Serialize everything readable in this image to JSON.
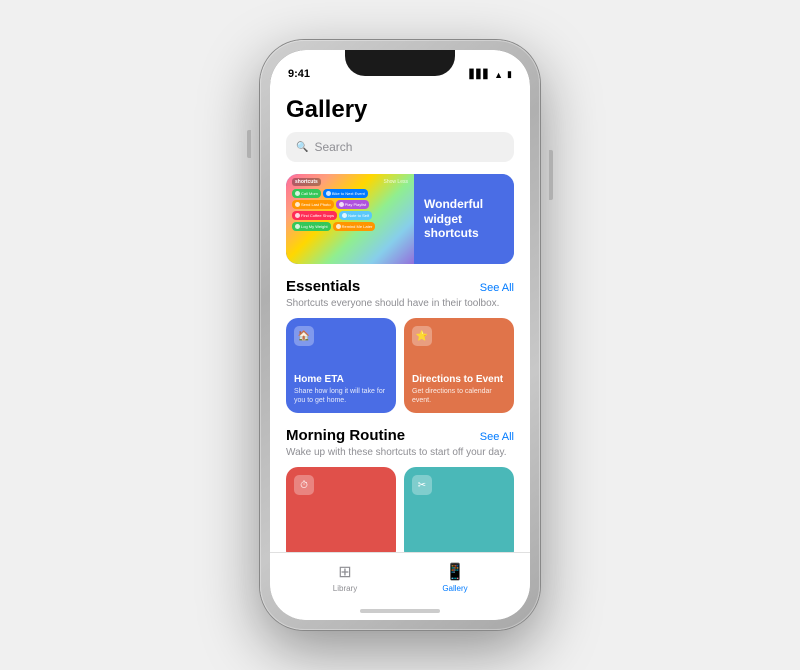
{
  "statusBar": {
    "time": "9:41",
    "signal": "▋▋▋",
    "wifi": "WiFi",
    "battery": "🔋"
  },
  "screen": {
    "title": "Gallery",
    "search": {
      "placeholder": "Search"
    },
    "featured": {
      "rightTitle": "Wonderful widget shortcuts",
      "shortcuts": [
        {
          "label": "Call Mom",
          "color": "#34c759"
        },
        {
          "label": "Bike to Next Event",
          "color": "#007aff"
        },
        {
          "label": "Send Last Photo",
          "color": "#ff9500"
        },
        {
          "label": "Play Playlist",
          "color": "#af52de"
        },
        {
          "label": "Find Coffee Shops",
          "color": "#ff2d55"
        },
        {
          "label": "Note to Self",
          "color": "#5ac8fa"
        },
        {
          "label": "Log My Weight",
          "color": "#34c759"
        },
        {
          "label": "Remind Me Later",
          "color": "#ff9500"
        }
      ]
    },
    "sections": [
      {
        "id": "essentials",
        "title": "Essentials",
        "seeAll": "See All",
        "description": "Shortcuts everyone should have in their toolbox.",
        "cards": [
          {
            "id": "home-eta",
            "title": "Home ETA",
            "description": "Share how long it will take for you to get home.",
            "color": "#4a6de5",
            "icon": "🏠"
          },
          {
            "id": "directions-event",
            "title": "Directions to Event",
            "description": "Get directions to calendar event.",
            "color": "#e0744a",
            "icon": "⭐"
          }
        ]
      },
      {
        "id": "morning-routine",
        "title": "Morning Routine",
        "seeAll": "See All",
        "description": "Wake up with these shortcuts to start off your day.",
        "cards": [
          {
            "id": "card-red",
            "title": "",
            "description": "",
            "color": "#e0504a",
            "icon": "⏱"
          },
          {
            "id": "card-teal",
            "title": "",
            "description": "",
            "color": "#4ab8b8",
            "icon": "✂"
          }
        ]
      }
    ],
    "tabBar": {
      "tabs": [
        {
          "id": "library",
          "label": "Library",
          "icon": "⊞",
          "active": false
        },
        {
          "id": "gallery",
          "label": "Gallery",
          "icon": "📱",
          "active": true
        }
      ]
    }
  }
}
